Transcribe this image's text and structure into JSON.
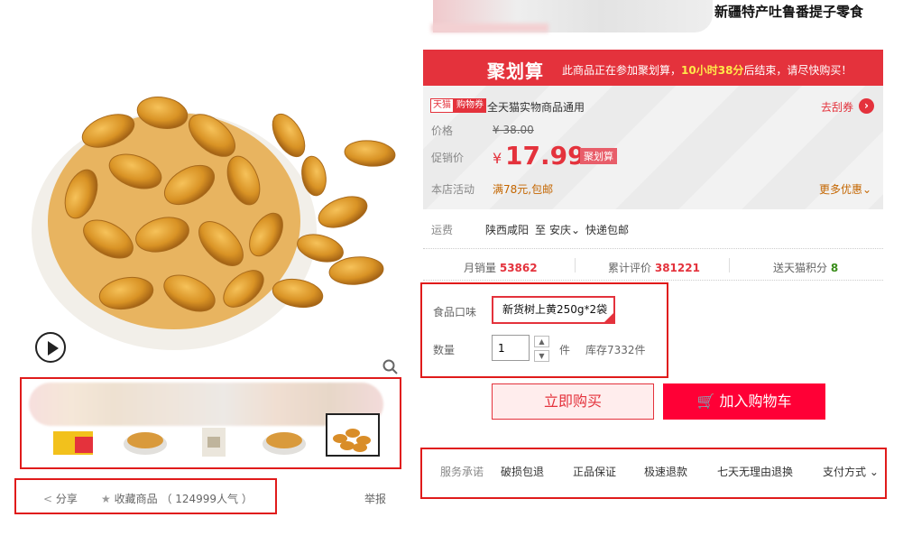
{
  "product": {
    "title": "新疆特产吐鲁番提子零食"
  },
  "juhuasuan": {
    "logo": "聚划算",
    "text_before": "此商品正在参加聚划算，",
    "time_left": "10小时38分",
    "text_after": "后结束，请尽快购买！"
  },
  "coupon": {
    "tag_tmall": "天猫",
    "tag_type": "购物券",
    "text": "全天猫实物商品通用",
    "grab_label": "去刮券"
  },
  "price": {
    "label": "价格",
    "original": "¥ 38.00",
    "promo_label": "促销价",
    "currency": "¥",
    "promo_value": "17.99",
    "promo_badge": "聚划算"
  },
  "activity": {
    "label": "本店活动",
    "value": "满78元,包邮",
    "more": "更多优惠"
  },
  "shipping": {
    "label": "运费",
    "from": "陕西咸阳",
    "to_label": "至",
    "to": "安庆",
    "method": "快递包邮"
  },
  "stats": {
    "monthly_sales_label": "月销量",
    "monthly_sales": "53862",
    "reviews_label": "累计评价",
    "reviews": "381221",
    "points_label": "送天猫积分",
    "points": "8"
  },
  "sku": {
    "flavor_label": "食品口味",
    "flavor_selected": "新货树上黄250g*2袋",
    "qty_label": "数量",
    "qty_value": "1",
    "unit": "件",
    "stock": "库存7332件"
  },
  "actions": {
    "buy_now": "立即购买",
    "add_to_cart": "加入购物车"
  },
  "services": {
    "label": "服务承诺",
    "items": [
      "破损包退",
      "正品保证",
      "极速退款",
      "七天无理由退换"
    ],
    "payment": "支付方式"
  },
  "social": {
    "share": "分享",
    "favorite": "收藏商品",
    "popularity": "（ 124999人气 ）",
    "report": "举报"
  },
  "colors": {
    "brand_red": "#e4323c",
    "cart_red": "#ff0036",
    "highlight_border": "#e01b1b"
  }
}
